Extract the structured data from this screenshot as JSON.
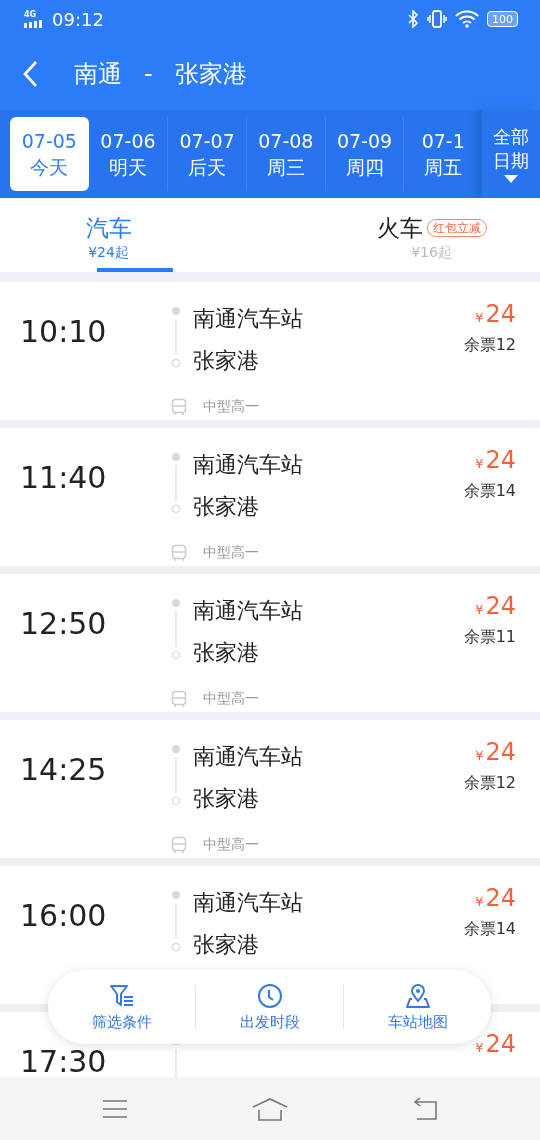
{
  "status_bar": {
    "network": "4G",
    "time": "09:12",
    "battery": "100"
  },
  "header": {
    "title_from": "南通",
    "separator": "-",
    "title_to": "张家港"
  },
  "dates": [
    {
      "date": "07-05",
      "day": "今天",
      "selected": true
    },
    {
      "date": "07-06",
      "day": "明天",
      "selected": false
    },
    {
      "date": "07-07",
      "day": "后天",
      "selected": false
    },
    {
      "date": "07-08",
      "day": "周三",
      "selected": false
    },
    {
      "date": "07-09",
      "day": "周四",
      "selected": false
    },
    {
      "date": "07-1",
      "day": "周五",
      "selected": false
    }
  ],
  "all_dates": {
    "label": "全部日期"
  },
  "modes": [
    {
      "label": "汽车",
      "price": "¥24起",
      "selected": true
    },
    {
      "label": "火车",
      "price": "¥16起",
      "badge": "红包立减",
      "selected": false
    }
  ],
  "trips": [
    {
      "time": "10:10",
      "from": "南通汽车站",
      "to": "张家港",
      "type": "中型高一",
      "price": "24",
      "seats": "余票12"
    },
    {
      "time": "11:40",
      "from": "南通汽车站",
      "to": "张家港",
      "type": "中型高一",
      "price": "24",
      "seats": "余票14"
    },
    {
      "time": "12:50",
      "from": "南通汽车站",
      "to": "张家港",
      "type": "中型高一",
      "price": "24",
      "seats": "余票11"
    },
    {
      "time": "14:25",
      "from": "南通汽车站",
      "to": "张家港",
      "type": "中型高一",
      "price": "24",
      "seats": "余票12"
    },
    {
      "time": "16:00",
      "from": "南通汽车站",
      "to": "张家港",
      "price": "24",
      "seats": "余票14"
    },
    {
      "time": "17:30",
      "price": "24"
    }
  ],
  "price_currency": "¥",
  "actions": [
    {
      "kind": "filter",
      "label": "筛选条件"
    },
    {
      "kind": "clock",
      "label": "出发时段"
    },
    {
      "kind": "map",
      "label": "车站地图"
    }
  ]
}
